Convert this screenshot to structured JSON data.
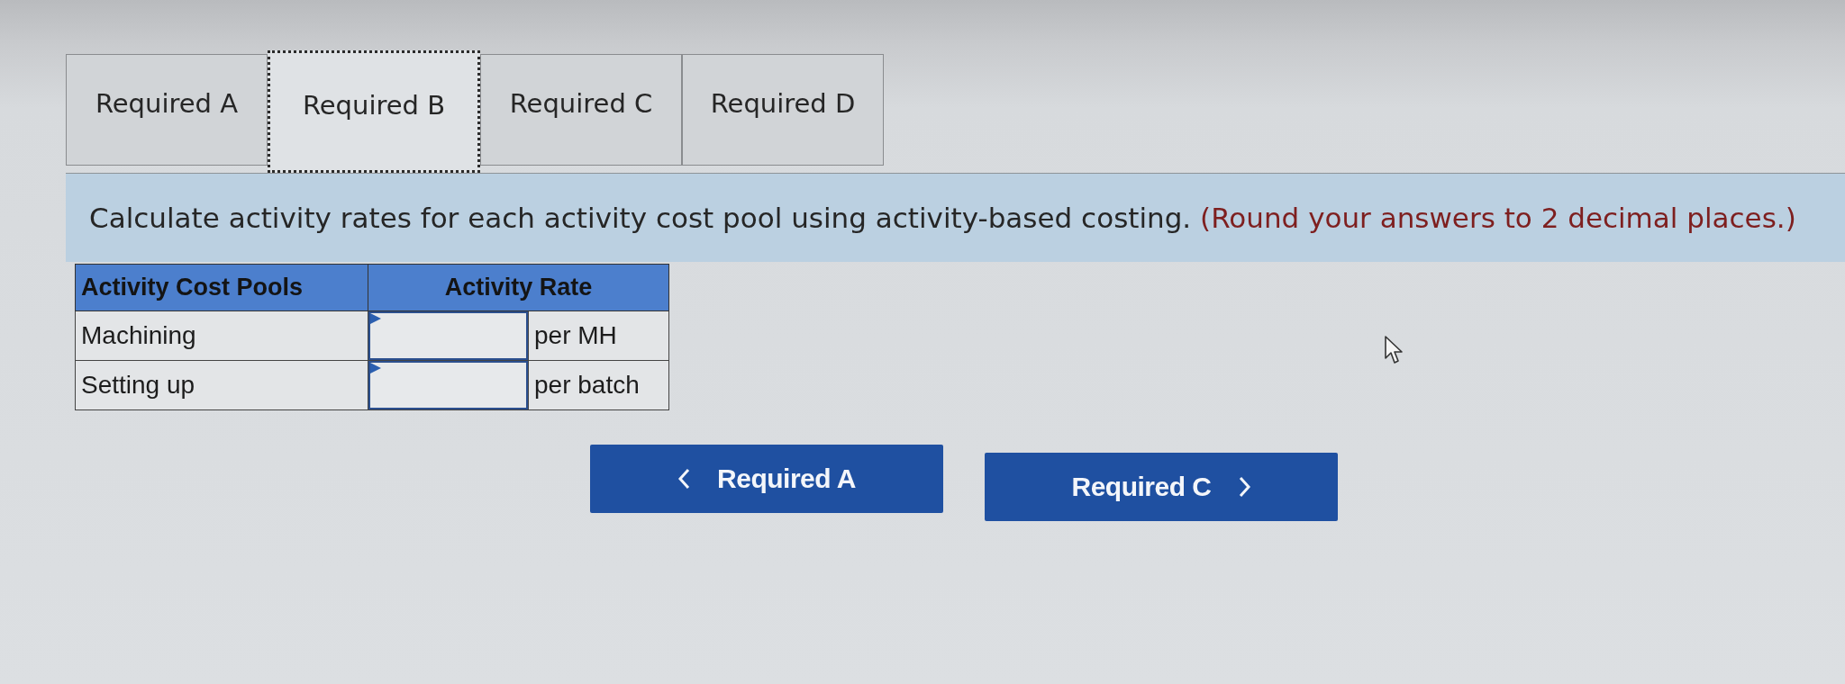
{
  "tabs": [
    {
      "label": "Required A",
      "selected": false
    },
    {
      "label": "Required B",
      "selected": true
    },
    {
      "label": "Required C",
      "selected": false
    },
    {
      "label": "Required D",
      "selected": false
    }
  ],
  "instruction": {
    "text": "Calculate activity rates for each activity cost pool using activity-based costing.",
    "note": "(Round your answers to 2 decimal places.)"
  },
  "table": {
    "columns": [
      "Activity Cost Pools",
      "Activity Rate"
    ],
    "rows": [
      {
        "pool": "Machining",
        "unit": "per MH"
      },
      {
        "pool": "Setting up",
        "unit": "per batch"
      }
    ]
  },
  "nav_buttons": [
    {
      "label": "Required A",
      "kind": "prev"
    },
    {
      "label": "Required C",
      "kind": "next"
    }
  ]
}
